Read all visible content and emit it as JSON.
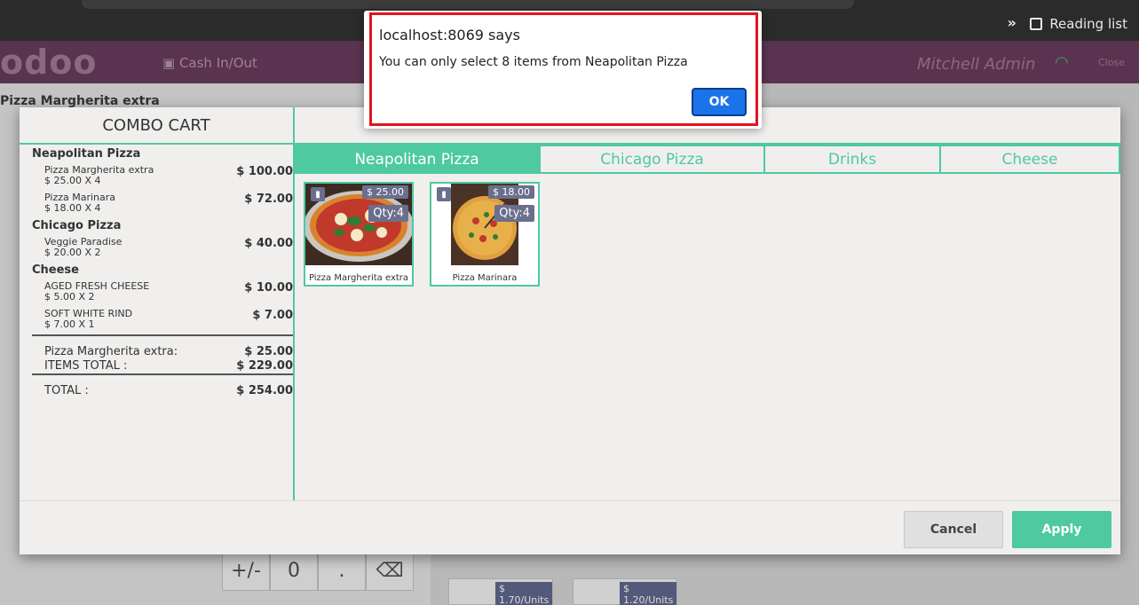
{
  "browser": {
    "reading_list": "Reading list",
    "chevron": "»"
  },
  "header": {
    "logo": "odoo",
    "cash_button": "Cash In/Out",
    "user": "Mitchell Admin",
    "close": "Close"
  },
  "background": {
    "order_title": "Pizza Margherita extra",
    "numpad": [
      "+/-",
      "0",
      ".",
      "⌫"
    ],
    "tile_prices": [
      "$ 1.70/Units",
      "$ 1.20/Units"
    ]
  },
  "alert": {
    "host": "localhost:8069 says",
    "message": "You can only select 8 items from Neapolitan Pizza",
    "ok_label": "OK"
  },
  "combo": {
    "cart_title": "COMBO CART",
    "groups": [
      {
        "name": "Neapolitan Pizza",
        "lines": [
          {
            "name": "Pizza Margherita extra",
            "qty": "$ 25.00 X 4",
            "price": "$ 100.00"
          },
          {
            "name": "Pizza Marinara",
            "qty": "$ 18.00 X 4",
            "price": "$ 72.00"
          }
        ]
      },
      {
        "name": "Chicago Pizza",
        "lines": [
          {
            "name": "Veggie Paradise",
            "qty": "$ 20.00 X 2",
            "price": "$ 40.00"
          }
        ]
      },
      {
        "name": "Cheese",
        "lines": [
          {
            "name": "AGED FRESH CHEESE",
            "qty": "$ 5.00 X 2",
            "price": "$ 10.00"
          },
          {
            "name": "SOFT WHITE RIND",
            "qty": "$ 7.00 X 1",
            "price": "$ 7.00"
          }
        ]
      }
    ],
    "summary": {
      "base_label": "Pizza Margherita extra:",
      "base_value": "$ 25.00",
      "items_label": "ITEMS TOTAL :",
      "items_value": "$ 229.00",
      "total_label": "TOTAL :",
      "total_value": "$ 254.00"
    },
    "tabs": [
      {
        "label": "Neapolitan Pizza",
        "active": true
      },
      {
        "label": "Chicago Pizza",
        "active": false
      },
      {
        "label": "Drinks",
        "active": false
      },
      {
        "label": "Cheese",
        "active": false
      }
    ],
    "products": [
      {
        "name": "Pizza Margherita extra",
        "price": "$ 25.00",
        "qty": "Qty:4",
        "icon": "trash-icon"
      },
      {
        "name": "Pizza Marinara",
        "price": "$ 18.00",
        "qty": "Qty:4",
        "icon": "trash-icon"
      }
    ],
    "cancel_label": "Cancel",
    "apply_label": "Apply"
  },
  "colors": {
    "accent": "#4ec9a0",
    "header": "#5a3350",
    "alert_border": "#e0141e",
    "ok_button": "#1a73e8",
    "tag": "#6b6f8e"
  }
}
